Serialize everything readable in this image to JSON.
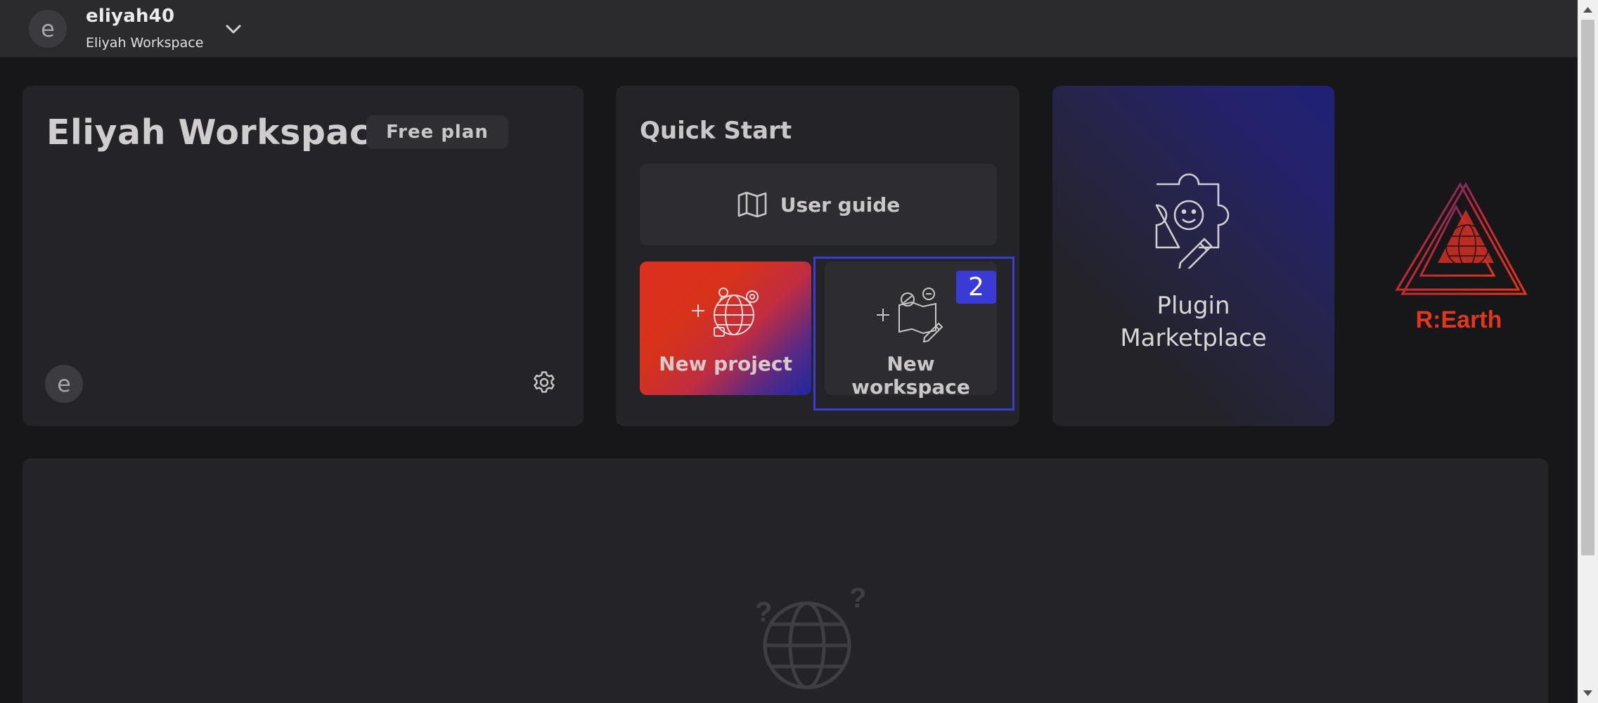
{
  "header": {
    "avatar_initial": "e",
    "username": "eliyah40",
    "workspace_name": "Eliyah Workspace"
  },
  "workspace_card": {
    "title": "Eliyah Workspace",
    "plan": "Free plan",
    "member_initial": "e"
  },
  "quick_start": {
    "title": "Quick Start",
    "user_guide_label": "User guide",
    "new_project_label": "New project",
    "new_workspace_label": "New workspace"
  },
  "plugin_marketplace": {
    "line1": "Plugin",
    "line2": "Marketplace"
  },
  "logo": {
    "text": "R:Earth"
  },
  "annotation": {
    "mark_number": "2"
  },
  "colors": {
    "background": "#171618",
    "card": "#242327",
    "accent_red": "#dd2f1f",
    "accent_blue": "#1e27a2",
    "highlight": "#3f3dd1"
  }
}
